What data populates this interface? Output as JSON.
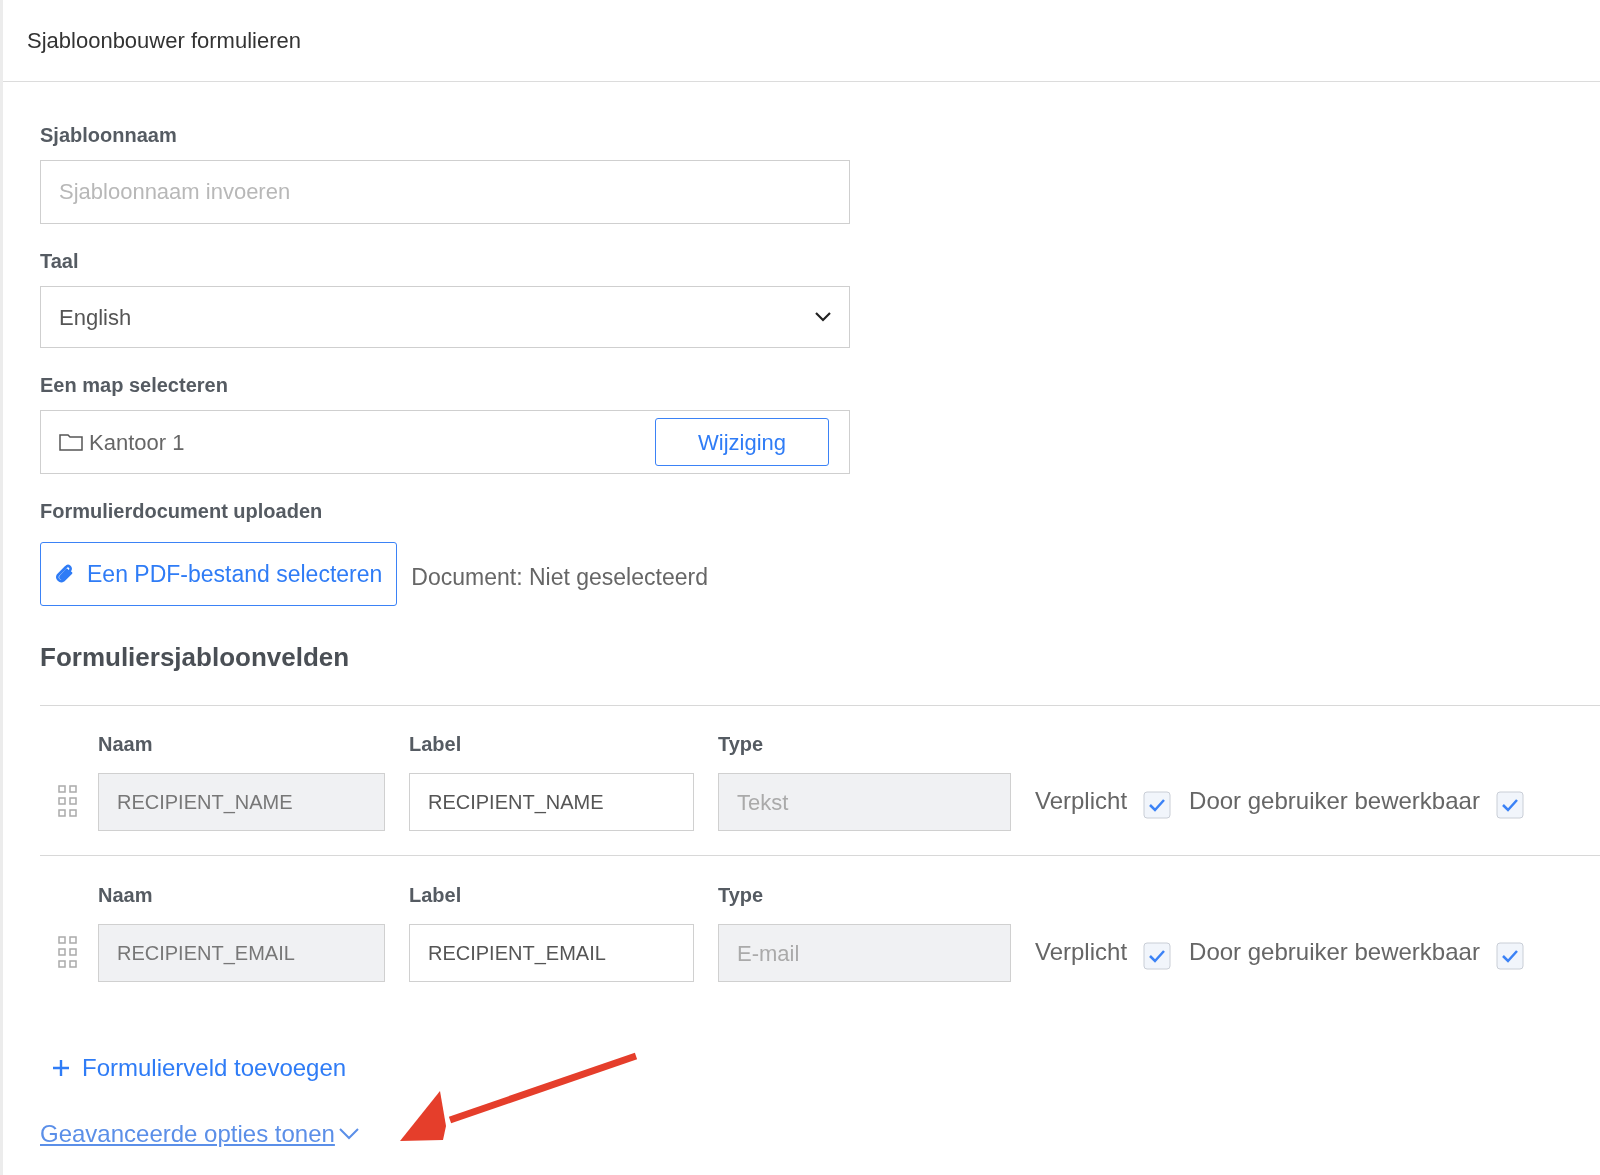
{
  "header": {
    "title": "Sjabloonbouwer formulieren"
  },
  "template_name": {
    "label": "Sjabloonnaam",
    "placeholder": "Sjabloonnaam invoeren"
  },
  "language": {
    "label": "Taal",
    "value": "English"
  },
  "folder": {
    "label": "Een map selecteren",
    "value": "Kantoor 1",
    "button": "Wijziging"
  },
  "upload": {
    "label": "Formulierdocument uploaden",
    "button": "Een PDF-bestand selecteren",
    "status": "Document: Niet geselecteerd"
  },
  "fields_section": {
    "title": "Formuliersjabloonvelden",
    "fields": [
      {
        "name_label": "Naam",
        "name": "RECIPIENT_NAME",
        "label_label": "Label",
        "label": "RECIPIENT_NAME",
        "type_label": "Type",
        "type": "Tekst",
        "required_label": "Verplicht",
        "required": true,
        "editable_label": "Door gebruiker bewerkbaar",
        "editable": true
      },
      {
        "name_label": "Naam",
        "name": "RECIPIENT_EMAIL",
        "label_label": "Label",
        "label": "RECIPIENT_EMAIL",
        "type_label": "Type",
        "type": "E-mail",
        "required_label": "Verplicht",
        "required": true,
        "editable_label": "Door gebruiker bewerkbaar",
        "editable": true
      }
    ],
    "add_button": "Formulierveld toevoegen"
  },
  "advanced_link": "Geavanceerde opties tonen"
}
